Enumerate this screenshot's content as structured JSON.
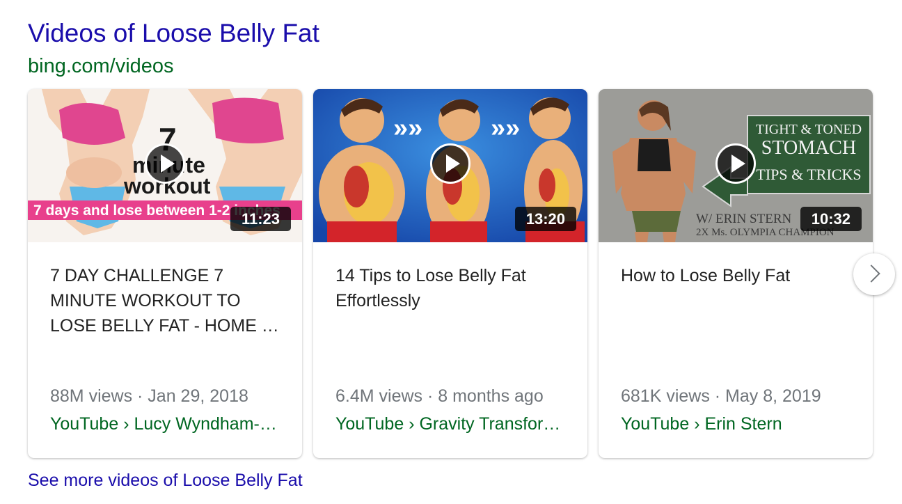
{
  "header": {
    "title": "Videos of Loose Belly Fat",
    "source": "bing.com/videos"
  },
  "cards": [
    {
      "duration": "11:23",
      "title": "7 DAY CHALLENGE 7 MINUTE WORKOUT TO LOSE BELLY FAT - HOME …",
      "meta": "88M views · Jan 29, 2018",
      "channel": "YouTube › Lucy Wyndham-…",
      "thumb_text": {
        "big_number": "7",
        "line1": "minute",
        "line2": "workout",
        "banner": "7 days and lose between 1-2 inches"
      }
    },
    {
      "duration": "13:20",
      "title": "14 Tips to Lose Belly Fat Effortlessly",
      "meta": "6.4M views · 8 months ago",
      "channel": "YouTube › Gravity Transfor…"
    },
    {
      "duration": "10:32",
      "title": "How to Lose Belly Fat",
      "meta": "681K views · May 8, 2019",
      "channel": "YouTube › Erin Stern",
      "thumb_text": {
        "line1": "TIGHT & TONED",
        "line2": "STOMACH",
        "line3": "TIPS & TRICKS",
        "credit1": "W/ ERIN STERN",
        "credit2": "2X Ms. OLYMPIA CHAMPION"
      }
    }
  ],
  "see_more": "See more videos of Loose Belly Fat",
  "icons": {
    "play": "play-icon",
    "next": "chevron-right-icon"
  },
  "colors": {
    "link": "#1a0dab",
    "source": "#006621",
    "meta": "#70757a"
  }
}
